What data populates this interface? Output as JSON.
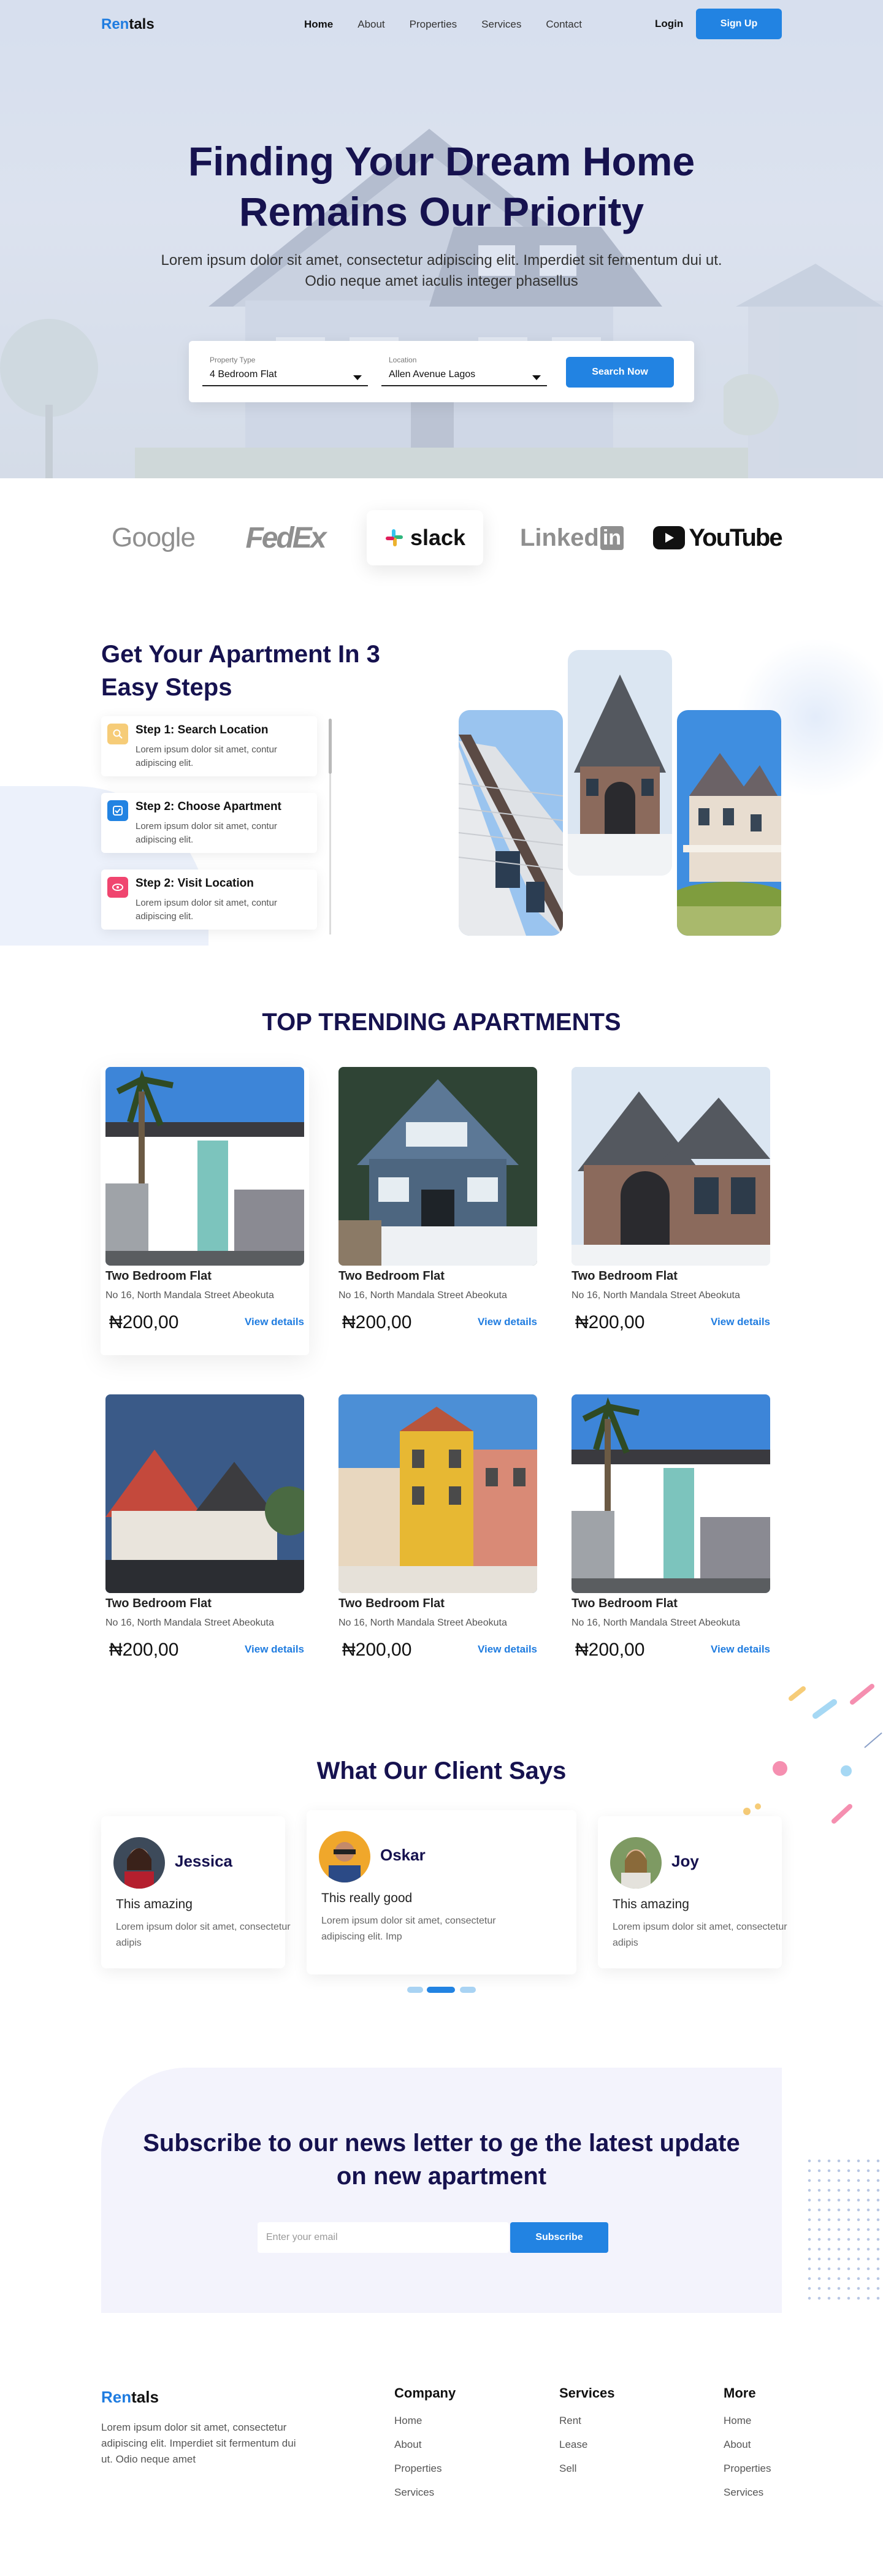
{
  "nav": {
    "logo_a": "Ren",
    "logo_b": "tals",
    "links": [
      "Home",
      "About",
      "Properties",
      "Services",
      "Contact"
    ],
    "login": "Login",
    "signup": "Sign Up"
  },
  "hero": {
    "title": "Finding Your Dream Home Remains Our Priority",
    "subtitle": "Lorem ipsum dolor sit amet, consectetur adipiscing elit. Imperdiet sit fermentum dui ut. Odio neque amet iaculis integer phasellus",
    "search": {
      "type_label": "Property Type",
      "type_value": "4 Bedroom Flat",
      "location_label": "Location",
      "location_value": "Allen Avenue Lagos",
      "button": "Search Now"
    }
  },
  "brands": [
    "Google",
    "FedEx",
    "slack",
    "Linked",
    "in",
    "YouTube"
  ],
  "steps": {
    "title": "Get Your Apartment In 3 Easy Steps",
    "items": [
      {
        "title": "Step 1: Search Location",
        "desc": "Lorem ipsum dolor sit amet, contur adipiscing elit.",
        "icon": "search-icon",
        "color": "#f6cc78"
      },
      {
        "title": "Step 2: Choose Apartment",
        "desc": "Lorem ipsum dolor sit amet, contur adipiscing elit.",
        "icon": "check-icon",
        "color": "#2283e2"
      },
      {
        "title": "Step 2: Visit Location",
        "desc": "Lorem ipsum dolor sit amet, contur adipiscing elit.",
        "icon": "eye-icon",
        "color": "#f0456f"
      }
    ]
  },
  "trending": {
    "title": "TOP TRENDING APARTMENTS",
    "cards": [
      {
        "name": "Two Bedroom Flat",
        "address": "No 16, North Mandala Street  Abeokuta",
        "price": "₦200,00",
        "link": "View details"
      },
      {
        "name": "Two Bedroom Flat",
        "address": "No 16, North Mandala Street  Abeokuta",
        "price": "₦200,00",
        "link": "View details"
      },
      {
        "name": "Two Bedroom Flat",
        "address": "No 16, North Mandala Street  Abeokuta",
        "price": "₦200,00",
        "link": "View details"
      },
      {
        "name": "Two Bedroom Flat",
        "address": "No 16, North Mandala Street  Abeokuta",
        "price": "₦200,00",
        "link": "View details"
      },
      {
        "name": "Two Bedroom Flat",
        "address": "No 16, North Mandala Street  Abeokuta",
        "price": "₦200,00",
        "link": "View details"
      },
      {
        "name": "Two Bedroom Flat",
        "address": "No 16, North Mandala Street  Abeokuta",
        "price": "₦200,00",
        "link": "View details"
      }
    ]
  },
  "testimonials": {
    "title": "What Our Client Says",
    "items": [
      {
        "name": "Jessica",
        "title": "This amazing",
        "body": "Lorem ipsum dolor sit amet, consectetur adipis"
      },
      {
        "name": "Oskar",
        "title": "This really good",
        "body": "Lorem ipsum dolor sit amet, consectetur adipiscing elit. Imp"
      },
      {
        "name": "Joy",
        "title": "This amazing",
        "body": "Lorem ipsum dolor sit amet, consectetur adipis"
      }
    ]
  },
  "subscribe": {
    "title": "Subscribe to our news letter to ge the latest update on new apartment",
    "placeholder": "Enter your email",
    "button": "Subscribe"
  },
  "footer": {
    "logo_a": "Ren",
    "logo_b": "tals",
    "desc": "Lorem ipsum dolor sit amet, consectetur adipiscing elit. Imperdiet sit fermentum dui ut. Odio neque amet",
    "columns": [
      {
        "heading": "Company",
        "items": [
          "Home",
          "About",
          "Properties",
          "Services"
        ]
      },
      {
        "heading": "Services",
        "items": [
          "Rent",
          "Lease",
          "Sell"
        ]
      },
      {
        "heading": "More",
        "items": [
          "Home",
          "About",
          "Properties",
          "Services"
        ]
      }
    ]
  },
  "colors": {
    "accent": "#2283e2",
    "heading": "#16124f"
  }
}
